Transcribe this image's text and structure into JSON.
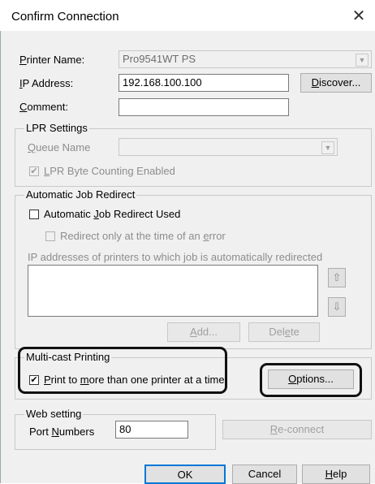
{
  "window": {
    "title": "Confirm Connection",
    "close_glyph": "✕"
  },
  "printer_name": {
    "label": "Printer Name:",
    "value": "Pro9541WT PS"
  },
  "ip_address": {
    "label": "IP Address:",
    "value": "192.168.100.100",
    "discover_label": "Discover..."
  },
  "comment": {
    "label": "Comment:",
    "value": ""
  },
  "lpr": {
    "group_title": "LPR Settings",
    "queue_label": "Queue Name",
    "queue_value": "",
    "byte_counting_label": "LPR Byte Counting Enabled",
    "byte_counting_checked": true
  },
  "auto_redirect": {
    "group_title": "Automatic Job Redirect",
    "used_label": "Automatic Job Redirect Used",
    "used_checked": false,
    "error_only_label": "Redirect only at the time of an error",
    "error_only_checked": false,
    "list_label": "IP addresses of printers to which job is automatically redirected",
    "add_label": "Add...",
    "delete_label": "Delete"
  },
  "multicast": {
    "group_title": "Multi-cast Printing",
    "print_more_label": "Print to more than one printer at a time",
    "print_more_checked": true,
    "options_label": "Options..."
  },
  "web": {
    "group_title": "Web setting",
    "port_label": "Port Numbers",
    "port_value": "80",
    "reconnect_label": "Re-connect"
  },
  "footer": {
    "ok_label": "OK",
    "cancel_label": "Cancel",
    "help_label": "Help"
  },
  "icons": {
    "check": "✔",
    "combo_arrow": "▼",
    "move_up": "⇧",
    "move_down": "⇩"
  }
}
